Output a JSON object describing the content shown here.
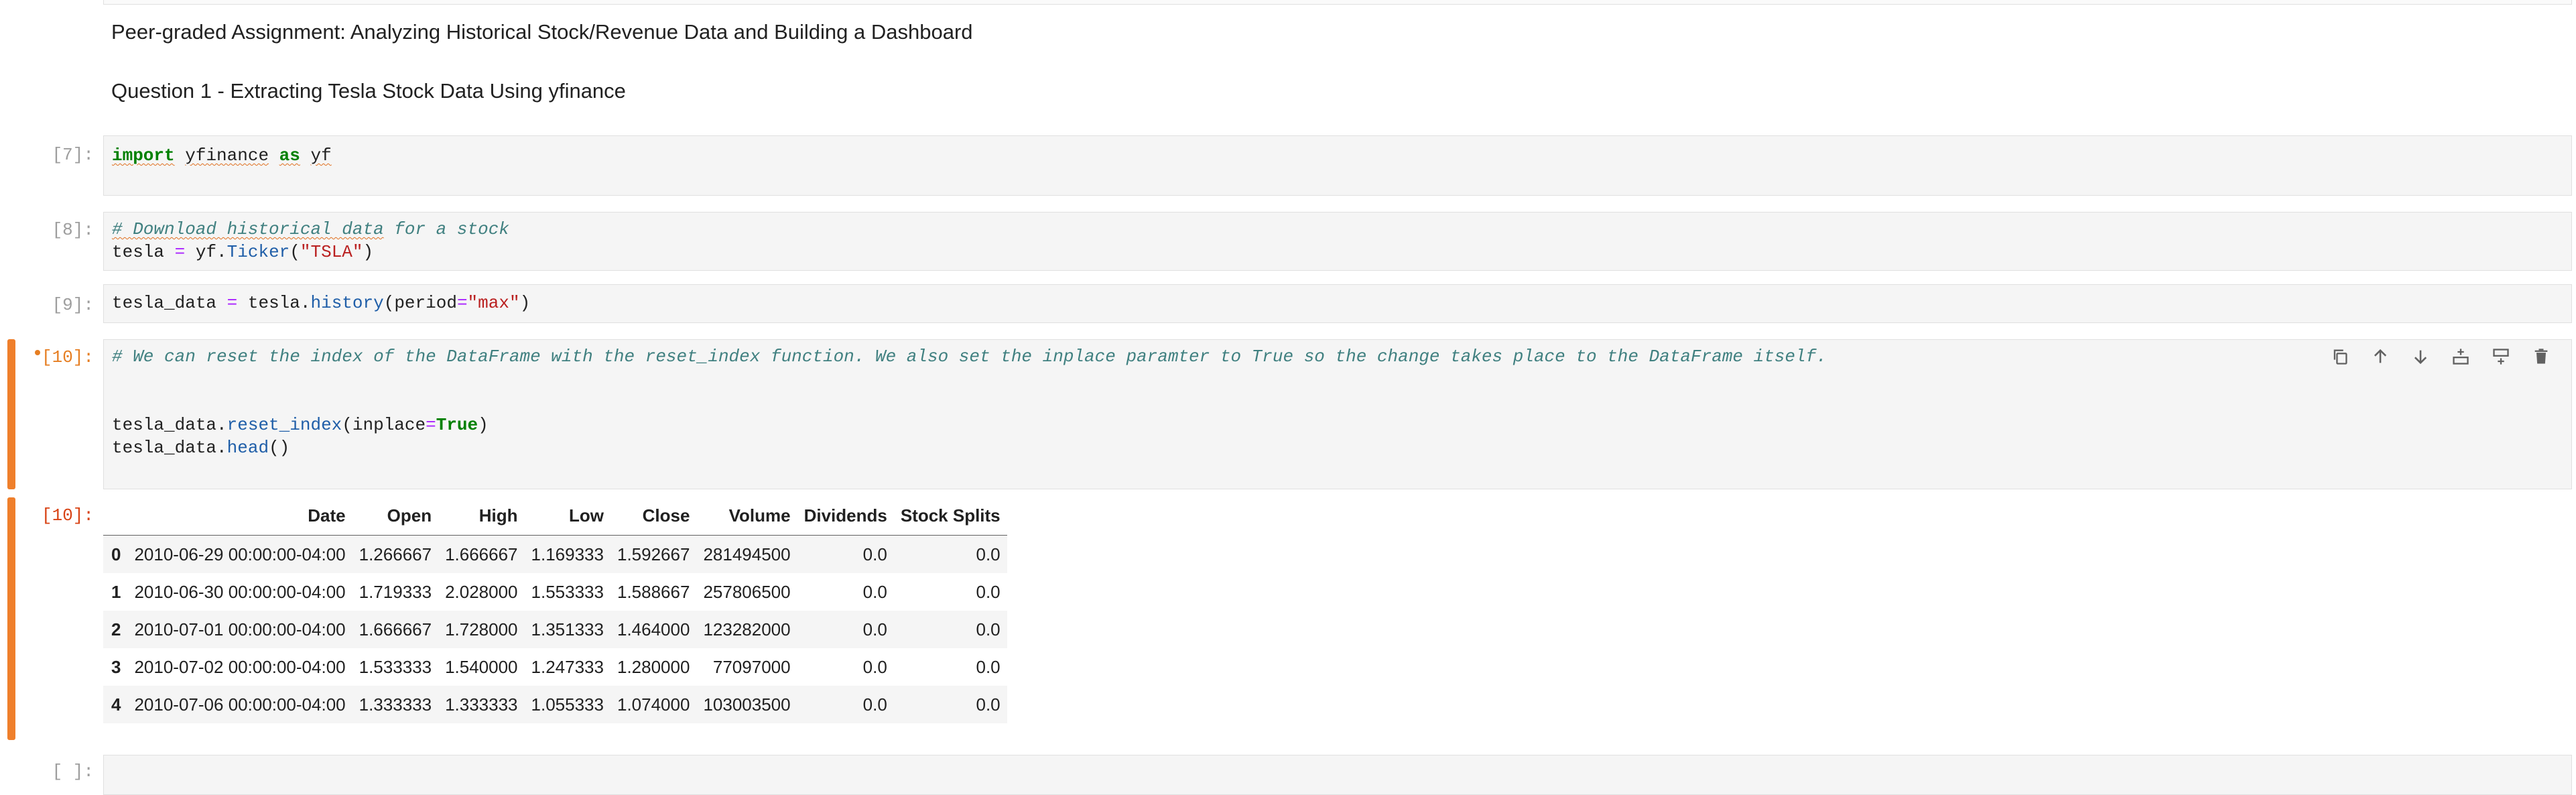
{
  "markdown": {
    "title": "Peer-graded Assignment: Analyzing Historical Stock/Revenue Data and Building a Dashboard",
    "question": "Question 1 - Extracting Tesla Stock Data Using yfinance"
  },
  "cells": [
    {
      "prompt": "[7]:"
    },
    {
      "prompt": "[8]:"
    },
    {
      "prompt": "[9]:"
    },
    {
      "prompt": "[10]:"
    },
    {
      "prompt": "[10]:"
    },
    {
      "prompt": "[ ]:"
    }
  ],
  "code": {
    "c7_import": "import",
    "c7_mod": "yfinance",
    "c7_as": "as",
    "c7_alias": "yf",
    "c8_comment_a": "# Download historical data",
    "c8_comment_b": " for a stock",
    "c8_var": "tesla",
    "c8_eq": "=",
    "c8_yf": "yf.",
    "c8_fn": "Ticker",
    "c8_str": "\"TSLA\"",
    "c9_var": "tesla_data",
    "c9_eq": "=",
    "c9_obj": "tesla.",
    "c9_fn": "history",
    "c9_arg": "period",
    "c9_str": "\"max\"",
    "c10_comment": "# We can reset the index of the DataFrame with the reset_index function. We also set the inplace paramter to True so the change takes place to the DataFrame itself.",
    "c10_obj1": "tesla_data.",
    "c10_fn1": "reset_index",
    "c10_arg": "inplace",
    "c10_true": "True",
    "c10_obj2": "tesla_data.",
    "c10_fn2": "head"
  },
  "toolbar": {
    "icons": [
      "copy-icon",
      "move-up-icon",
      "move-down-icon",
      "insert-above-icon",
      "insert-below-icon",
      "delete-icon"
    ]
  },
  "dataframe": {
    "columns": [
      "Date",
      "Open",
      "High",
      "Low",
      "Close",
      "Volume",
      "Dividends",
      "Stock Splits"
    ],
    "rows": [
      {
        "index": "0",
        "Date": "2010-06-29 00:00:00-04:00",
        "Open": "1.266667",
        "High": "1.666667",
        "Low": "1.169333",
        "Close": "1.592667",
        "Volume": "281494500",
        "Dividends": "0.0",
        "Stock Splits": "0.0"
      },
      {
        "index": "1",
        "Date": "2010-06-30 00:00:00-04:00",
        "Open": "1.719333",
        "High": "2.028000",
        "Low": "1.553333",
        "Close": "1.588667",
        "Volume": "257806500",
        "Dividends": "0.0",
        "Stock Splits": "0.0"
      },
      {
        "index": "2",
        "Date": "2010-07-01 00:00:00-04:00",
        "Open": "1.666667",
        "High": "1.728000",
        "Low": "1.351333",
        "Close": "1.464000",
        "Volume": "123282000",
        "Dividends": "0.0",
        "Stock Splits": "0.0"
      },
      {
        "index": "3",
        "Date": "2010-07-02 00:00:00-04:00",
        "Open": "1.533333",
        "High": "1.540000",
        "Low": "1.247333",
        "Close": "1.280000",
        "Volume": "77097000",
        "Dividends": "0.0",
        "Stock Splits": "0.0"
      },
      {
        "index": "4",
        "Date": "2010-07-06 00:00:00-04:00",
        "Open": "1.333333",
        "High": "1.333333",
        "Low": "1.055333",
        "Close": "1.074000",
        "Volume": "103003500",
        "Dividends": "0.0",
        "Stock Splits": "0.0"
      }
    ]
  },
  "colors": {
    "active_cell_bar": "#ef7f2b",
    "keyword": "#008000",
    "string": "#ba2121",
    "comment": "#408080",
    "function": "#1f5ea8"
  }
}
